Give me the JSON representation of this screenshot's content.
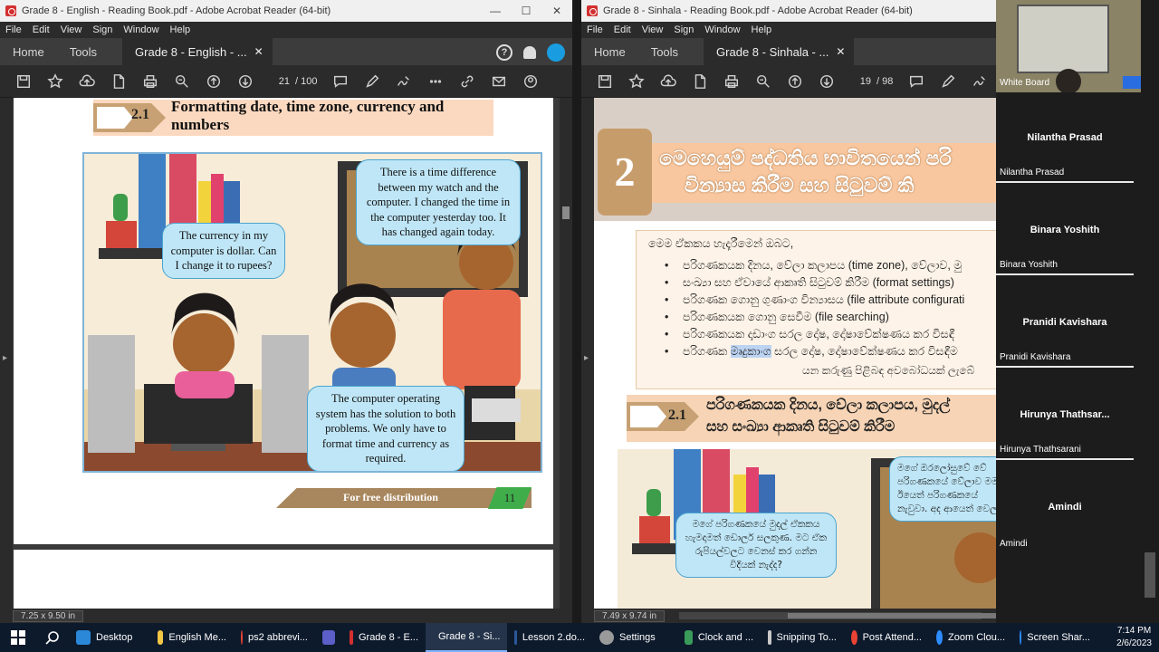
{
  "left_window": {
    "title": "Grade 8 - English - Reading Book.pdf - Adobe Acrobat Reader (64-bit)",
    "menu": [
      "File",
      "Edit",
      "View",
      "Sign",
      "Window",
      "Help"
    ],
    "tabs": {
      "home": "Home",
      "tools": "Tools",
      "doc": "Grade 8 - English - ..."
    },
    "page_current": "21",
    "page_total": "/ 100",
    "page_size": "7.25 x 9.50 in",
    "section_number": "2.1",
    "section_title": "Formatting date, time zone, currency and numbers",
    "bubbles": {
      "watch": "There is a time difference between my watch and the computer. I changed the time in the computer yesterday too. It has changed again today.",
      "currency": "The currency in my computer is dollar. Can I change it to rupees?",
      "solution": "The computer operating system has the solution to both problems. We only have to format time and currency as required."
    },
    "footer": "For free distribution",
    "page_number": "11"
  },
  "right_window": {
    "title": "Grade 8 - Sinhala - Reading Book.pdf - Adobe Acrobat Reader (64-bit)",
    "menu": [
      "File",
      "Edit",
      "View",
      "Sign",
      "Window",
      "Help"
    ],
    "tabs": {
      "home": "Home",
      "tools": "Tools",
      "doc": "Grade 8 - Sinhala - ..."
    },
    "page_current": "19",
    "page_total": "/ 98",
    "page_size": "7.49 x 9.74 in",
    "chapter_number": "2",
    "chapter_title_line1": "මෙහෙයුම් පද්ධතිය භාවිතයෙන් පරි",
    "chapter_title_line2": "වින්‍යාස කිරීම සහ සිටුවම් කි",
    "intro": "මෙම ඒකකය හැදෑරීමෙන් ඔබට,",
    "list": [
      "පරිගණකයක දිනය, වේලා කලාපය (time zone), වේලාව, මු",
      "සංඛ්‍යා සහ ඒවායේ ආකෘති සිටුවම් කිරීම (format settings)",
      "පරිගණක ගොනු ගුණාංග වින්‍යාසය (file attribute configurati",
      "පරිගණකයක ගොනු සෙවීම (file searching)",
      "පරිගණකයක දෘඩාංග සරල දෝෂ, දෝෂාවේක්ෂණය කර විසඳී",
      "පරිගණක මෘදුකාංග සරල දෝෂ, දෝෂාවේක්ෂණය කර විසඳීම"
    ],
    "list_highlight": "මෘදුකාංග",
    "foot_text": "යන කරුණු පිළිබඳ අවබෝධයක් ලැබේ",
    "section_number": "2.1",
    "section_title_line1": "පරිගණකයක දිනය, වේලා කලාපය, මුදල්",
    "section_title_line2": "සහ සංඛ්‍යා ආකෘති සිටුවම් කිරීම",
    "bubble_watch": "මගේ ඔරලෝසුවේ වේ පරිගණකයේ වේලාව මම ඊයෙත් පරිගණකයේ නැවුවා. අද ආයෙත් වෙලා.",
    "bubble_currency": "මගේ පරිගණකයේ මුදල් ඒකකය හැමදාමත් ඩොලර් සලකුණ. මට ඒක රුපියල්වලට වෙනස් කර ගන්න විදියක් නැද්ද?"
  },
  "zoom": {
    "video_label": "White Board",
    "participants": [
      {
        "display": "Nilantha Prasad",
        "label": "Nilantha Prasad"
      },
      {
        "display": "Binara Yoshith",
        "label": "Binara Yoshith"
      },
      {
        "display": "Pranidi Kavishara",
        "label": "Pranidi Kavishara"
      },
      {
        "display": "Hirunya  Thathsar...",
        "label": "Hirunya Thathsarani"
      },
      {
        "display": "Amindi",
        "label": "Amindi"
      }
    ]
  },
  "taskbar": {
    "items": [
      {
        "label": "Desktop",
        "icon": "desktop-icon",
        "color": "#2b88d8"
      },
      {
        "label": "English Me...",
        "icon": "folder-icon",
        "color": "#f2c744"
      },
      {
        "label": "ps2 abbrevi...",
        "icon": "chrome-icon",
        "color": "#e94335"
      },
      {
        "label": "",
        "icon": "teams-icon",
        "color": "#5b5fc7"
      },
      {
        "label": "Grade 8 - E...",
        "icon": "acrobat-icon",
        "color": "#d32f2f"
      },
      {
        "label": "Grade 8 - Si...",
        "icon": "acrobat-icon",
        "color": "#d32f2f"
      },
      {
        "label": "Lesson 2.do...",
        "icon": "word-icon",
        "color": "#2b579a"
      },
      {
        "label": "Settings",
        "icon": "gear-icon",
        "color": "#9a9a9a"
      },
      {
        "label": "Clock and ...",
        "icon": "control-panel-icon",
        "color": "#3a9a5a"
      },
      {
        "label": "Snipping To...",
        "icon": "scissors-icon",
        "color": "#c8c8c8"
      },
      {
        "label": "Post Attend...",
        "icon": "chrome-icon",
        "color": "#e94335"
      },
      {
        "label": "Zoom Clou...",
        "icon": "zoom-icon",
        "color": "#2d8cff"
      },
      {
        "label": "Screen Shar...",
        "icon": "zoom-icon",
        "color": "#2d8cff"
      }
    ],
    "time": "7:14 PM",
    "date": "2/6/2023"
  }
}
